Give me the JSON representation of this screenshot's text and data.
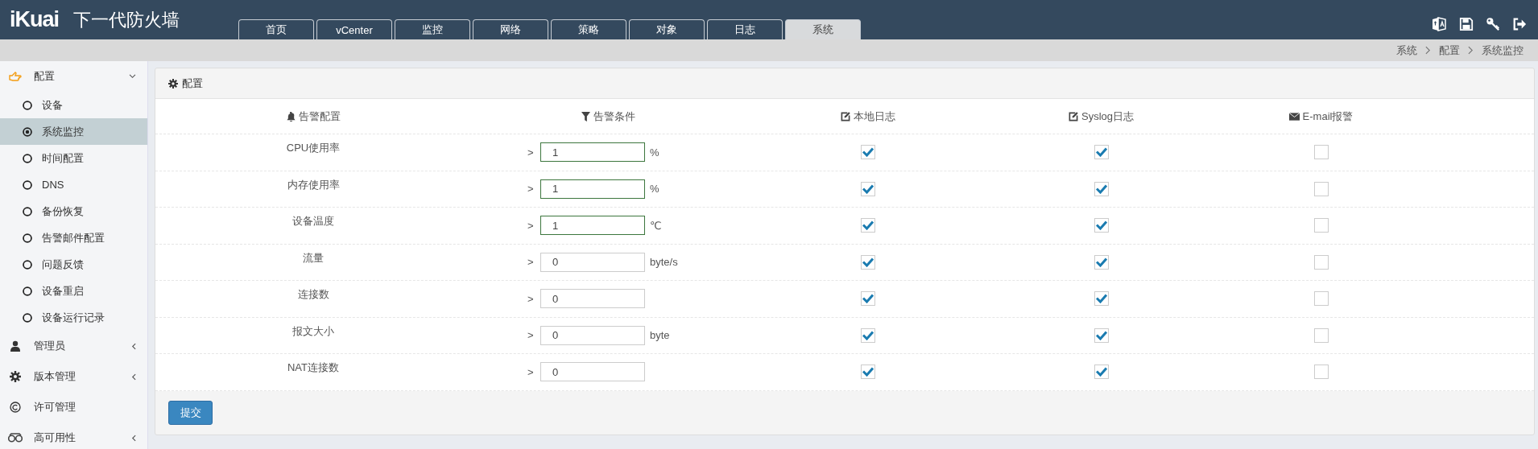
{
  "header": {
    "logo": "iKuai",
    "product": "下一代防火墙",
    "tabs": [
      {
        "label": "首页",
        "selected": false
      },
      {
        "label": "vCenter",
        "selected": false
      },
      {
        "label": "监控",
        "selected": false
      },
      {
        "label": "网络",
        "selected": false
      },
      {
        "label": "策略",
        "selected": false
      },
      {
        "label": "对象",
        "selected": false
      },
      {
        "label": "日志",
        "selected": false
      },
      {
        "label": "系统",
        "selected": true
      }
    ]
  },
  "breadcrumb": [
    "系统",
    "配置",
    "系统监控"
  ],
  "sidebar": {
    "items": [
      {
        "label": "配置",
        "kind": "group",
        "expanded": true,
        "children": [
          {
            "label": "设备",
            "selected": false
          },
          {
            "label": "系统监控",
            "selected": true
          },
          {
            "label": "时间配置",
            "selected": false
          },
          {
            "label": "DNS",
            "selected": false
          },
          {
            "label": "备份恢复",
            "selected": false
          },
          {
            "label": "告警邮件配置",
            "selected": false
          },
          {
            "label": "问题反馈",
            "selected": false
          },
          {
            "label": "设备重启",
            "selected": false
          },
          {
            "label": "设备运行记录",
            "selected": false
          }
        ]
      },
      {
        "label": "管理员",
        "kind": "group",
        "expanded": false
      },
      {
        "label": "版本管理",
        "kind": "group",
        "expanded": false
      },
      {
        "label": "许可管理",
        "kind": "link"
      },
      {
        "label": "高可用性",
        "kind": "group",
        "expanded": false
      }
    ]
  },
  "panel": {
    "title": "配置",
    "columns": [
      {
        "label": "告警配置"
      },
      {
        "label": "告警条件"
      },
      {
        "label": "本地日志"
      },
      {
        "label": "Syslog日志"
      },
      {
        "label": "E-mail报警"
      }
    ],
    "rows": [
      {
        "name": "CPU使用率",
        "operator": ">",
        "value": "1",
        "unit": "%",
        "highlighted": true,
        "local_log": true,
        "syslog": true,
        "email": false
      },
      {
        "name": "内存使用率",
        "operator": ">",
        "value": "1",
        "unit": "%",
        "highlighted": true,
        "local_log": true,
        "syslog": true,
        "email": false
      },
      {
        "name": "设备温度",
        "operator": ">",
        "value": "1",
        "unit": "℃",
        "highlighted": true,
        "local_log": true,
        "syslog": true,
        "email": false
      },
      {
        "name": "流量",
        "operator": ">",
        "value": "0",
        "unit": "byte/s",
        "highlighted": false,
        "local_log": true,
        "syslog": true,
        "email": false
      },
      {
        "name": "连接数",
        "operator": ">",
        "value": "0",
        "highlighted": false,
        "local_log": true,
        "syslog": true,
        "email": false
      },
      {
        "name": "报文大小",
        "operator": ">",
        "value": "0",
        "unit": "byte",
        "highlighted": false,
        "local_log": true,
        "syslog": true,
        "email": false
      },
      {
        "name": "NAT连接数",
        "operator": ">",
        "value": "0",
        "highlighted": false,
        "local_log": true,
        "syslog": true,
        "email": false
      }
    ],
    "submit": "提交"
  }
}
